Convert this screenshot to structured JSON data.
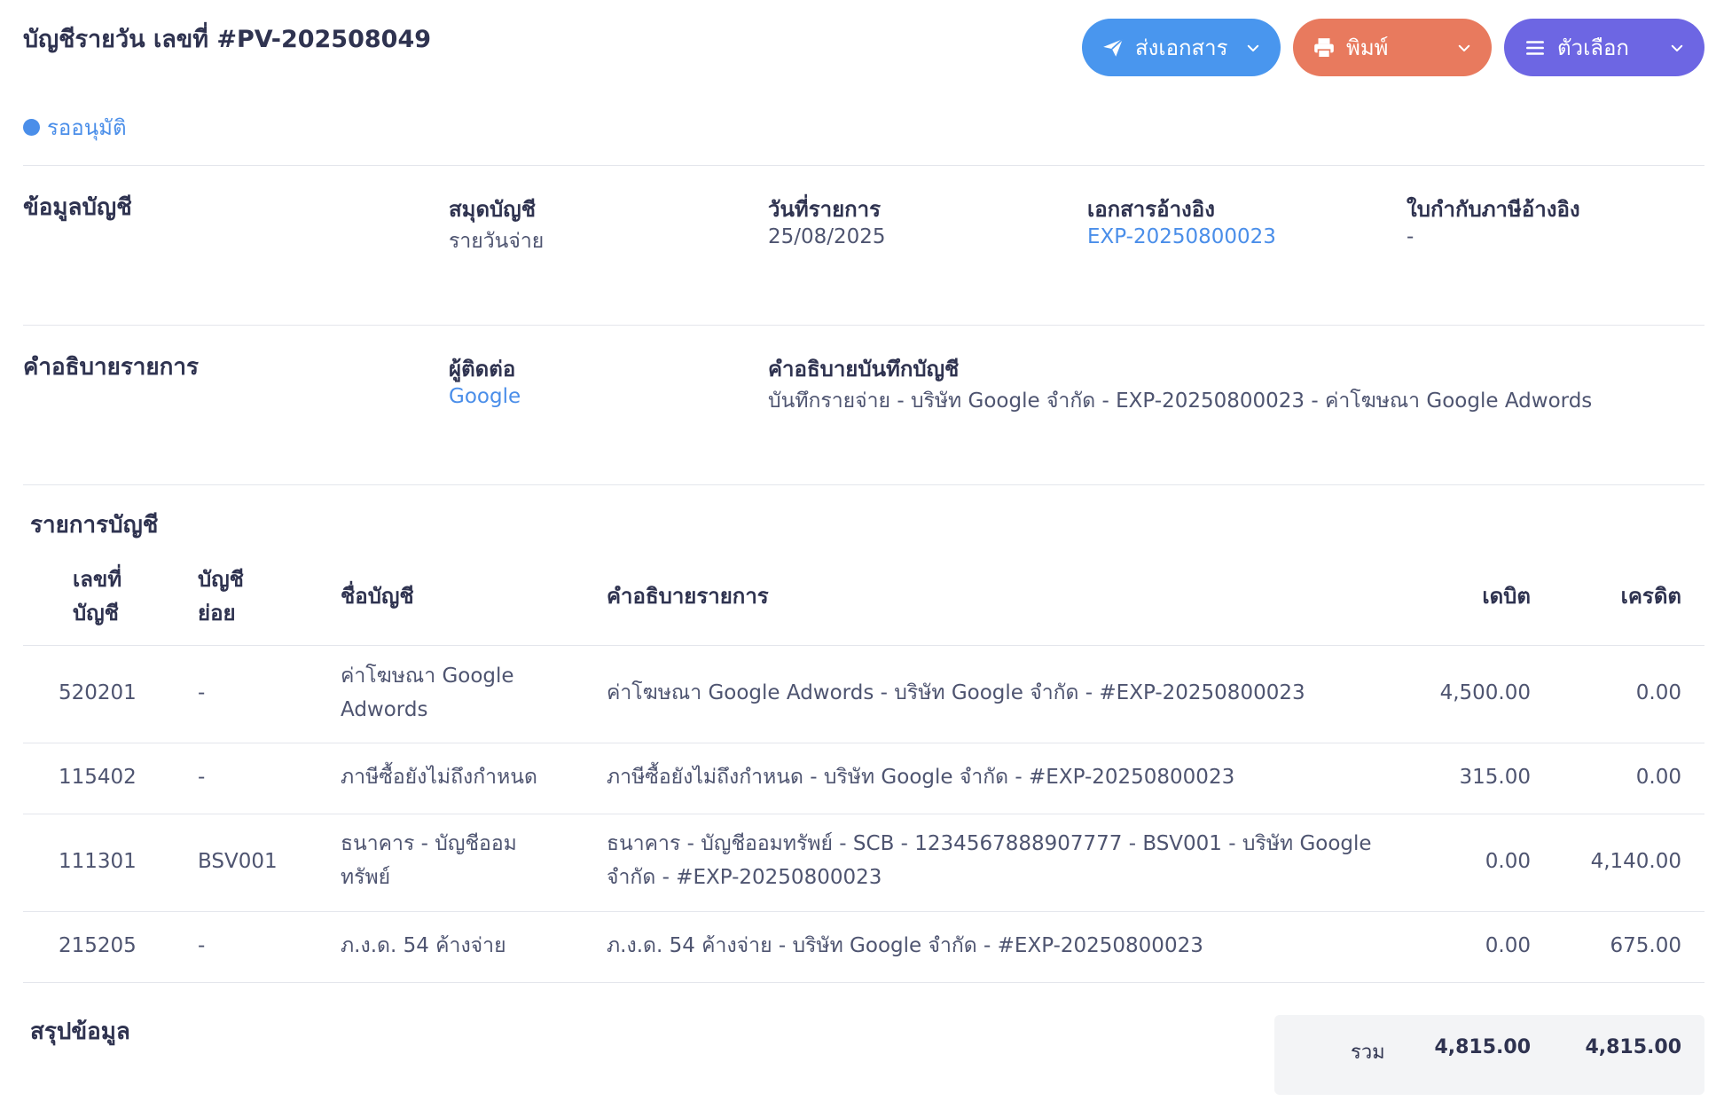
{
  "header": {
    "title": "บัญชีรายวัน เลขที่ #PV-202508049",
    "status": "รออนุมัติ",
    "buttons": {
      "send": "ส่งเอกสาร",
      "print": "พิมพ์",
      "options": "ตัวเลือก"
    }
  },
  "account_info": {
    "section_title": "ข้อมูลบัญชี",
    "journal_label": "สมุดบัญชี",
    "journal_value": "รายวันจ่าย",
    "date_label": "วันที่รายการ",
    "date_value": "25/08/2025",
    "ref_doc_label": "เอกสารอ้างอิง",
    "ref_doc_value": "EXP-20250800023",
    "tax_ref_label": "ใบกำกับภาษีอ้างอิง",
    "tax_ref_value": "-"
  },
  "description": {
    "section_title": "คำอธิบายรายการ",
    "contact_label": "ผู้ติดต่อ",
    "contact_value": "Google",
    "note_label": "คำอธิบายบันทึกบัญชี",
    "note_value": "บันทึกรายจ่าย - บริษัท Google จำกัด - EXP-20250800023 - ค่าโฆษณา Google Adwords"
  },
  "entries": {
    "section_title": "รายการบัญชี",
    "headers": {
      "acc_no_1": "เลขที่",
      "acc_no_2": "บัญชี",
      "sub_1": "บัญชี",
      "sub_2": "ย่อย",
      "name": "ชื่อบัญชี",
      "desc": "คำอธิบายรายการ",
      "debit": "เดบิต",
      "credit": "เครดิต"
    },
    "rows": [
      {
        "acc": "520201",
        "sub": "-",
        "name_1": "ค่าโฆษณา Google",
        "name_2": "Adwords",
        "desc_1": "ค่าโฆษณา Google Adwords - บริษัท Google จำกัด - #EXP-20250800023",
        "desc_2": "",
        "debit": "4,500.00",
        "credit": "0.00"
      },
      {
        "acc": "115402",
        "sub": "-",
        "name_1": "ภาษีซื้อยังไม่ถึงกำหนด",
        "name_2": "",
        "desc_1": "ภาษีซื้อยังไม่ถึงกำหนด - บริษัท Google จำกัด - #EXP-20250800023",
        "desc_2": "",
        "debit": "315.00",
        "credit": "0.00"
      },
      {
        "acc": "111301",
        "sub": "BSV001",
        "name_1": "ธนาคาร - บัญชีออม",
        "name_2": "ทรัพย์",
        "desc_1": "ธนาคาร - บัญชีออมทรัพย์ - SCB - 1234567888907777 - BSV001 - บริษัท Google",
        "desc_2": "จำกัด - #EXP-20250800023",
        "debit": "0.00",
        "credit": "4,140.00"
      },
      {
        "acc": "215205",
        "sub": "-",
        "name_1": "ภ.ง.ด. 54 ค้างจ่าย",
        "name_2": "",
        "desc_1": "ภ.ง.ด. 54 ค้างจ่าย - บริษัท Google จำกัด - #EXP-20250800023",
        "desc_2": "",
        "debit": "0.00",
        "credit": "675.00"
      }
    ]
  },
  "summary": {
    "section_title": "สรุปข้อมูล",
    "total_label": "รวม",
    "total_debit": "4,815.00",
    "total_credit": "4,815.00"
  }
}
